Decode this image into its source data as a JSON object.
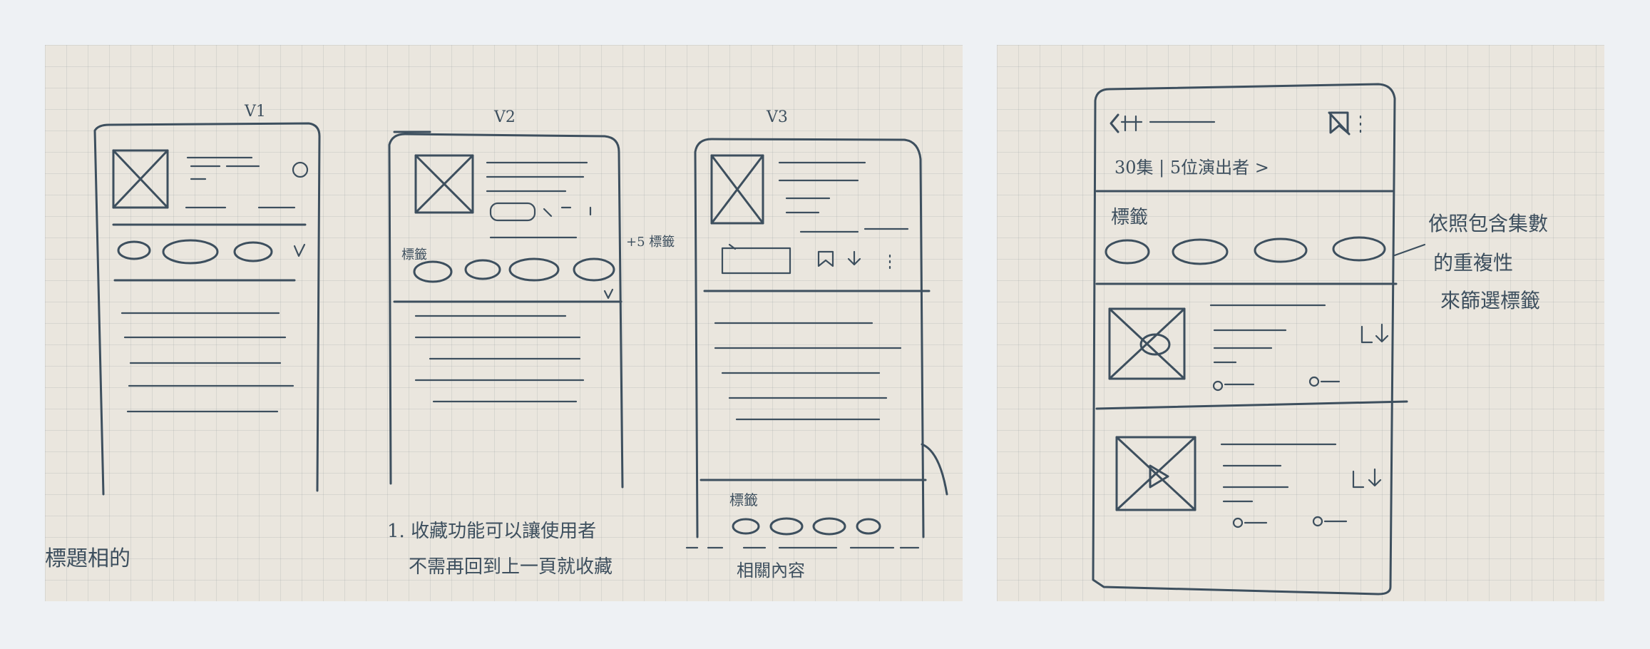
{
  "sketch_left": {
    "labels": {
      "v1": "V1",
      "v2": "V2",
      "v3": "V3",
      "side_note_tags": "+5 標籤",
      "tag_label_v2": "標籤",
      "tag_label_v3": "標籤",
      "related_content": "相關內容",
      "note_line1": "1. 收藏功能可以讓使用者",
      "note_line2": "不需再回到上一頁就收藏",
      "bottom_left_note": "標題相的"
    }
  },
  "sketch_right": {
    "labels": {
      "episode_line": "30集 | 5位演出者 >",
      "tag_title": "標籤",
      "annotation_line1": "依照包含集數",
      "annotation_line2": "的重複性",
      "annotation_line3": "來篩選標籤"
    },
    "icons": [
      "back-arrow-icon",
      "bookmark-icon",
      "more-vert-icon",
      "download-icon",
      "play-icon"
    ]
  },
  "colors": {
    "background": "#eef1f4",
    "paper": "#eae6de",
    "ink": "#3d4f5e"
  }
}
